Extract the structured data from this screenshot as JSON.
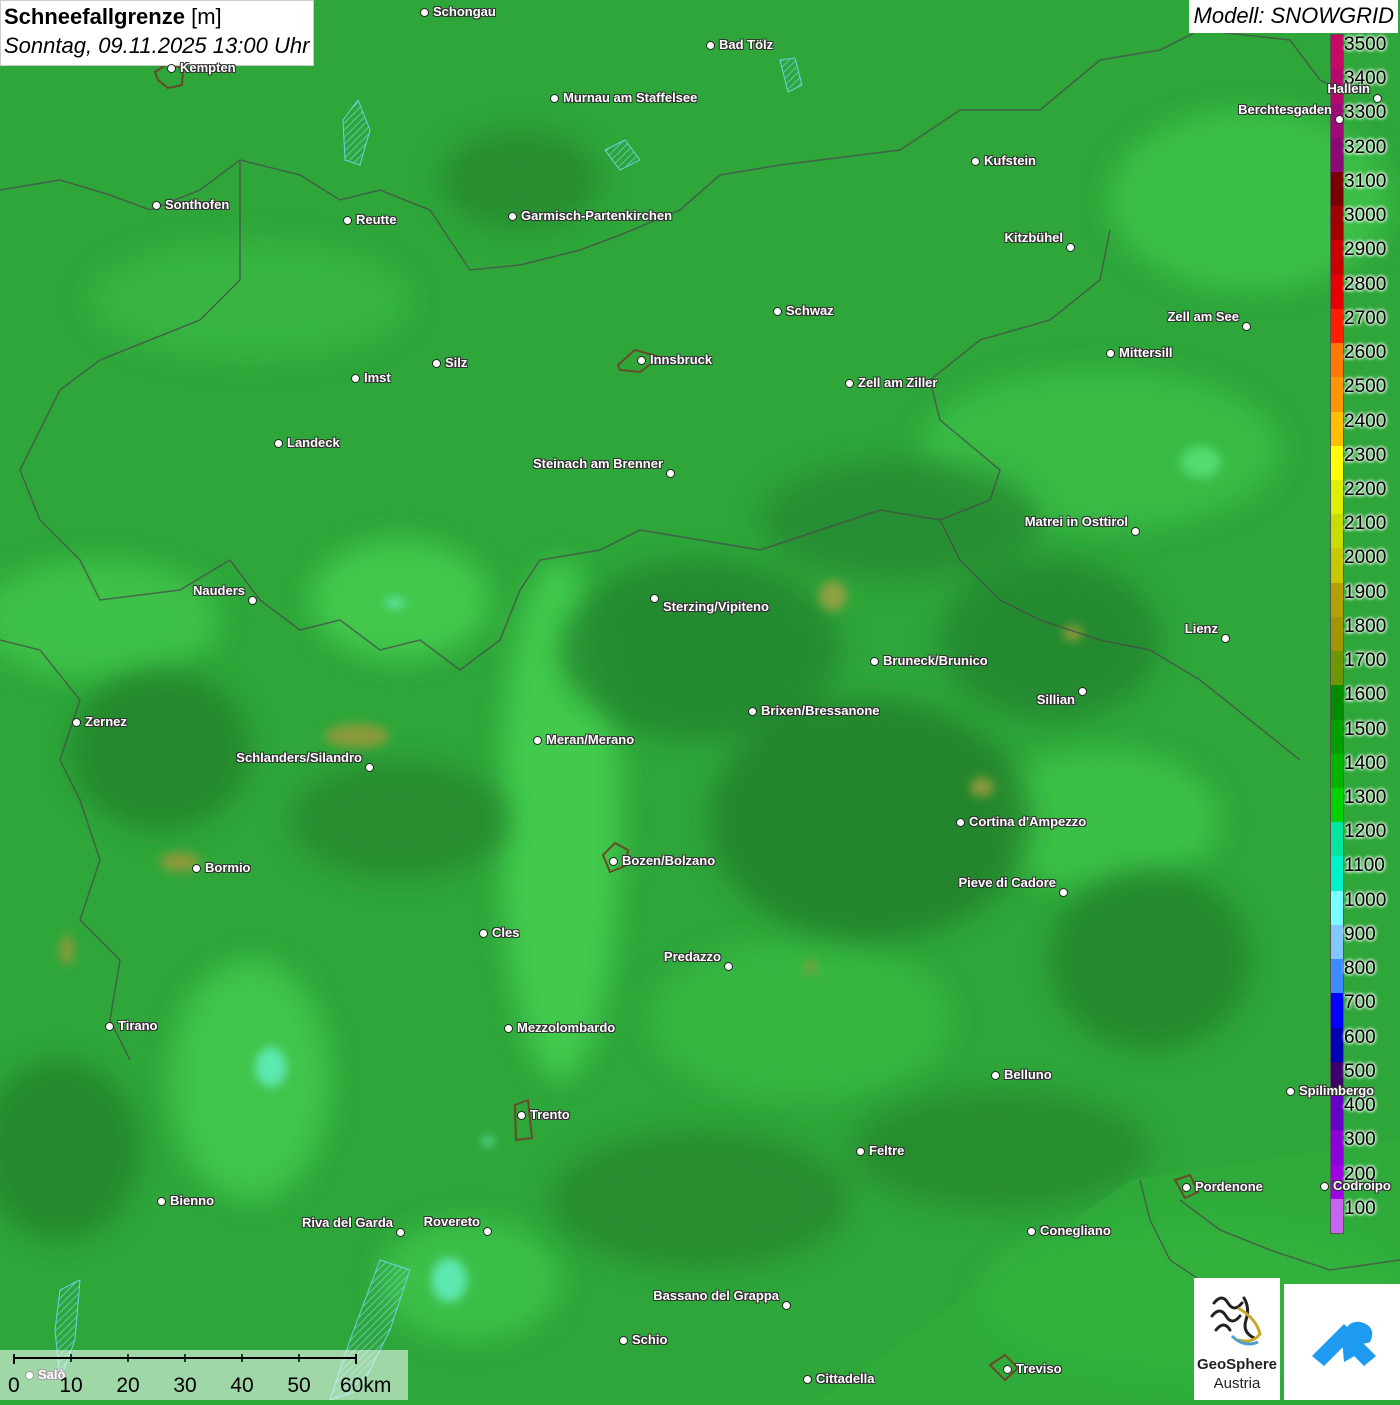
{
  "title": {
    "main": "Schneefallgrenze",
    "unit": "[m]",
    "datetime": "Sonntag, 09.11.2025 13:00 Uhr"
  },
  "model": "Modell: SNOWGRID",
  "legend": {
    "levels": [
      {
        "label": "3500",
        "color": "#c80a64"
      },
      {
        "label": "3400",
        "color": "#b40a6e"
      },
      {
        "label": "3300",
        "color": "#a00a78"
      },
      {
        "label": "3200",
        "color": "#8c0a78"
      },
      {
        "label": "3100",
        "color": "#7a0000"
      },
      {
        "label": "3000",
        "color": "#a00000"
      },
      {
        "label": "2900",
        "color": "#c80000"
      },
      {
        "label": "2800",
        "color": "#e60000"
      },
      {
        "label": "2700",
        "color": "#ff1e00"
      },
      {
        "label": "2600",
        "color": "#ff7800"
      },
      {
        "label": "2500",
        "color": "#ff9600"
      },
      {
        "label": "2400",
        "color": "#ffbe00"
      },
      {
        "label": "2300",
        "color": "#ffff00"
      },
      {
        "label": "2200",
        "color": "#dcf000"
      },
      {
        "label": "2100",
        "color": "#c8dc00"
      },
      {
        "label": "2000",
        "color": "#c8c800"
      },
      {
        "label": "1900",
        "color": "#b4a000"
      },
      {
        "label": "1800",
        "color": "#a09600"
      },
      {
        "label": "1700",
        "color": "#6e9600"
      },
      {
        "label": "1600",
        "color": "#008c00"
      },
      {
        "label": "1500",
        "color": "#00a000"
      },
      {
        "label": "1400",
        "color": "#00b400"
      },
      {
        "label": "1300",
        "color": "#00d200"
      },
      {
        "label": "1200",
        "color": "#00e6a0"
      },
      {
        "label": "1100",
        "color": "#00f0c8"
      },
      {
        "label": "1000",
        "color": "#78ffff"
      },
      {
        "label": "900",
        "color": "#82c8ff"
      },
      {
        "label": "800",
        "color": "#3c8cff"
      },
      {
        "label": "700",
        "color": "#0000ff"
      },
      {
        "label": "600",
        "color": "#0000b4"
      },
      {
        "label": "500",
        "color": "#3c006e"
      },
      {
        "label": "400",
        "color": "#6400c8"
      },
      {
        "label": "300",
        "color": "#8c00dc"
      },
      {
        "label": "200",
        "color": "#a000e6"
      },
      {
        "label": "100",
        "color": "#c864f0"
      }
    ]
  },
  "cities": [
    {
      "name": "Schongau"
    },
    {
      "name": "Bad Tölz"
    },
    {
      "name": "Kempten"
    },
    {
      "name": "Murnau am Staffelsee"
    },
    {
      "name": "Hallein"
    },
    {
      "name": "Berchtesgaden"
    },
    {
      "name": "Kufstein"
    },
    {
      "name": "Sonthofen"
    },
    {
      "name": "Reutte"
    },
    {
      "name": "Garmisch-Partenkirchen"
    },
    {
      "name": "Kitzbühel"
    },
    {
      "name": "Schwaz"
    },
    {
      "name": "Zell am See"
    },
    {
      "name": "Innsbruck"
    },
    {
      "name": "Mittersill"
    },
    {
      "name": "Silz"
    },
    {
      "name": "Imst"
    },
    {
      "name": "Zell am Ziller"
    },
    {
      "name": "Landeck"
    },
    {
      "name": "Steinach am Brenner"
    },
    {
      "name": "Matrei in Osttirol"
    },
    {
      "name": "Nauders"
    },
    {
      "name": "Sterzing/Vipiteno"
    },
    {
      "name": "Lienz"
    },
    {
      "name": "Bruneck/Brunico"
    },
    {
      "name": "Sillian"
    },
    {
      "name": "Zernez"
    },
    {
      "name": "Brixen/Bressanone"
    },
    {
      "name": "Meran/Merano"
    },
    {
      "name": "Schlanders/Silandro"
    },
    {
      "name": "Cortina d'Ampezzo"
    },
    {
      "name": "Bozen/Bolzano"
    },
    {
      "name": "Bormio"
    },
    {
      "name": "Pieve di Cadore"
    },
    {
      "name": "Cles"
    },
    {
      "name": "Predazzo"
    },
    {
      "name": "Tirano"
    },
    {
      "name": "Mezzolombardo"
    },
    {
      "name": "Belluno"
    },
    {
      "name": "Spilimbergo"
    },
    {
      "name": "Trento"
    },
    {
      "name": "Feltre"
    },
    {
      "name": "Bienno"
    },
    {
      "name": "Pordenone"
    },
    {
      "name": "Codroipo"
    },
    {
      "name": "Riva del Garda"
    },
    {
      "name": "Rovereto"
    },
    {
      "name": "Conegliano"
    },
    {
      "name": "Bassano del Grappa"
    },
    {
      "name": "Schio"
    },
    {
      "name": "Treviso"
    },
    {
      "name": "Cittadella"
    },
    {
      "name": "Salò"
    }
  ],
  "scale": {
    "labels": [
      "0",
      "10",
      "20",
      "30",
      "40",
      "50",
      "60km"
    ]
  },
  "logo": {
    "name_line1": "GeoSphere",
    "name_line2": "Austria"
  }
}
